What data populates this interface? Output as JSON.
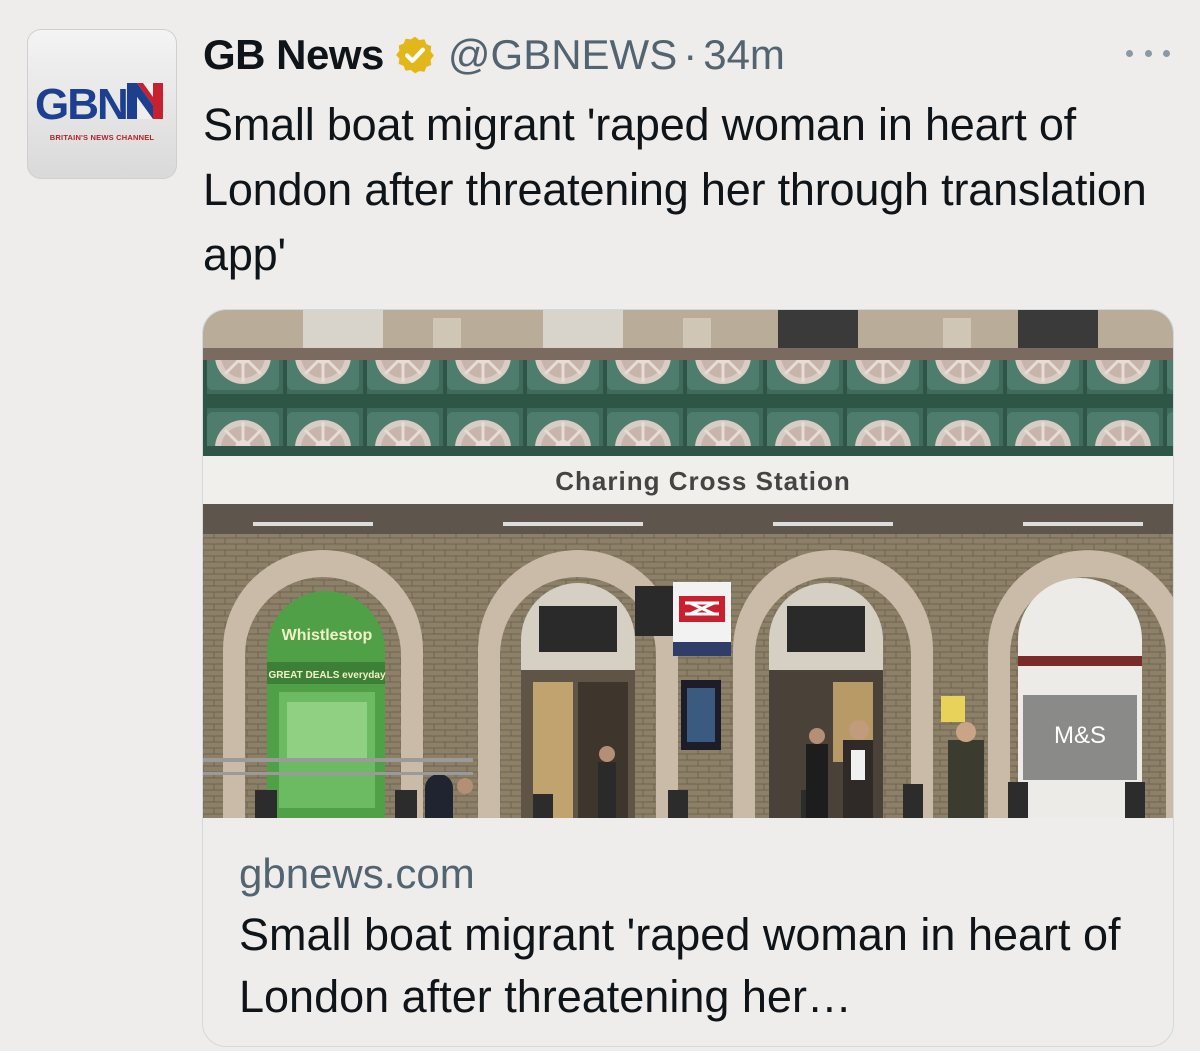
{
  "account": {
    "name": "GB News",
    "handle": "@GBNEWS",
    "separator": "·",
    "time": "34m",
    "verified": true,
    "avatar_text": "GBN",
    "avatar_tagline": "BRITAIN'S NEWS CHANNEL"
  },
  "tweet": {
    "text": "Small boat migrant 'raped woman in heart of London after threatening her through translation app'"
  },
  "card": {
    "image": {
      "sign_text": "Charing Cross Station",
      "shop_left": "Whistlestop",
      "shop_left_sub": "GREAT DEALS everyday",
      "shop_right": "M&S"
    },
    "domain": "gbnews.com",
    "title": "Small boat migrant 'raped woman in heart of London after threatening her…"
  },
  "colors": {
    "background": "#efedec",
    "text": "#0f1419",
    "secondary_text": "#536471",
    "verified_badge": "#e2b719",
    "brand_blue": "#1d3f8f",
    "brand_red": "#c8202f"
  },
  "icons": {
    "verified": "verified-badge-icon",
    "more": "more-options-icon"
  }
}
